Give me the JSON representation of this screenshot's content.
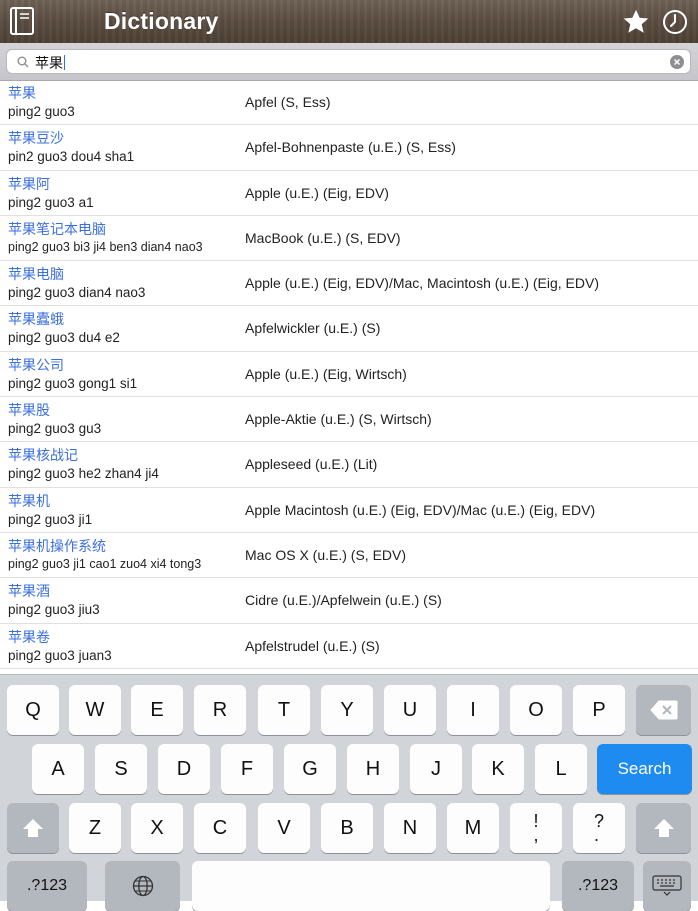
{
  "header": {
    "title": "Dictionary"
  },
  "search": {
    "query": "苹果"
  },
  "results": [
    {
      "hanzi": "苹果",
      "pinyin": "ping2 guo3",
      "meaning": "Apfel (S, Ess)"
    },
    {
      "hanzi": "苹果豆沙",
      "pinyin": "pin2 guo3 dou4 sha1",
      "meaning": "Apfel-Bohnenpaste (u.E.) (S, Ess)"
    },
    {
      "hanzi": "苹果阿",
      "pinyin": "ping2 guo3 a1",
      "meaning": "Apple (u.E.) (Eig, EDV)"
    },
    {
      "hanzi": "苹果笔记本电脑",
      "pinyin": "ping2 guo3 bi3 ji4 ben3 dian4 nao3",
      "meaning": "MacBook (u.E.) (S, EDV)"
    },
    {
      "hanzi": "苹果电脑",
      "pinyin": "ping2 guo3 dian4 nao3",
      "meaning": "Apple (u.E.) (Eig, EDV)/Mac, Macintosh (u.E.) (Eig, EDV)"
    },
    {
      "hanzi": "苹果蠹蛾",
      "pinyin": "ping2 guo3 du4 e2",
      "meaning": "Apfelwickler (u.E.) (S)"
    },
    {
      "hanzi": "苹果公司",
      "pinyin": "ping2 guo3 gong1 si1",
      "meaning": "Apple (u.E.) (Eig, Wirtsch)"
    },
    {
      "hanzi": "苹果股",
      "pinyin": "ping2 guo3 gu3",
      "meaning": "Apple-Aktie (u.E.) (S, Wirtsch)"
    },
    {
      "hanzi": "苹果核战记",
      "pinyin": "ping2 guo3 he2 zhan4 ji4",
      "meaning": "Appleseed (u.E.) (Lit)"
    },
    {
      "hanzi": "苹果机",
      "pinyin": "ping2 guo3 ji1",
      "meaning": "Apple Macintosh (u.E.) (Eig, EDV)/Mac (u.E.) (Eig, EDV)"
    },
    {
      "hanzi": "苹果机操作系统",
      "pinyin": "ping2 guo3 ji1 cao1 zuo4 xi4 tong3",
      "meaning": "Mac OS X (u.E.) (S, EDV)"
    },
    {
      "hanzi": "苹果酒",
      "pinyin": "ping2 guo3 jiu3",
      "meaning": "Cidre (u.E.)/Apfelwein (u.E.) (S)"
    },
    {
      "hanzi": "苹果卷",
      "pinyin": "ping2 guo3 juan3",
      "meaning": "Apfelstrudel (u.E.) (S)"
    }
  ],
  "keyboard": {
    "row1": [
      "Q",
      "W",
      "E",
      "R",
      "T",
      "Y",
      "U",
      "I",
      "O",
      "P"
    ],
    "row2": [
      "A",
      "S",
      "D",
      "F",
      "G",
      "H",
      "J",
      "K",
      "L"
    ],
    "row3": [
      "Z",
      "X",
      "C",
      "V",
      "B",
      "N",
      "M",
      "!\n,",
      "?\n."
    ],
    "search_label": "Search",
    "numbers_label": ".?123"
  },
  "colors": {
    "link": "#3b6fe0",
    "search_key": "#1e8bf0",
    "header": "#5a4c40"
  }
}
